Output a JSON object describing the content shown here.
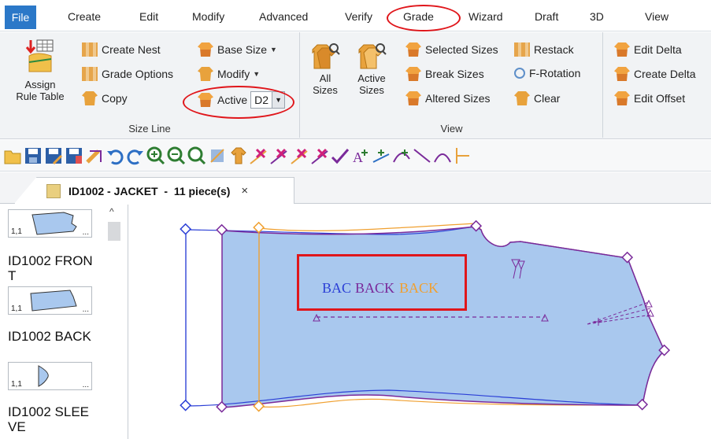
{
  "menu": {
    "file": "File",
    "items": [
      "Create",
      "Edit",
      "Modify",
      "Advanced",
      "Verify",
      "Grade",
      "Wizard",
      "Draft",
      "3D",
      "View"
    ]
  },
  "ribbon": {
    "size_line": {
      "group_label": "Size Line",
      "assign_rule_table": "Assign\nRule Table",
      "create_nest": "Create Nest",
      "grade_options": "Grade Options",
      "copy": "Copy",
      "base_size": "Base Size",
      "modify": "Modify",
      "active_label": "Active",
      "active_value": "D2"
    },
    "view": {
      "group_label": "View",
      "all_sizes": "All\nSizes",
      "active_sizes": "Active\nSizes",
      "selected_sizes": "Selected Sizes",
      "break_sizes": "Break Sizes",
      "altered_sizes": "Altered Sizes",
      "restack": "Restack",
      "f_rotation": "F-Rotation",
      "clear": "Clear"
    },
    "delta": {
      "edit_delta": "Edit Delta",
      "create_delta": "Create Delta",
      "edit_offset": "Edit Offset"
    }
  },
  "toolbar": {
    "icons": [
      "open-icon",
      "save-icon",
      "save-as-icon",
      "save-all-icon",
      "export-icon",
      "undo-icon",
      "redo-icon",
      "zoom-in-icon",
      "zoom-out-icon",
      "zoom-fit-icon",
      "grade-icon",
      "size-icon",
      "delete-point-icon",
      "delete-line-icon",
      "cut-icon",
      "cut-line-icon",
      "check-icon",
      "add-text-icon",
      "add-point-icon",
      "add-curve-icon",
      "line-icon",
      "curve-icon",
      "split-icon"
    ]
  },
  "tab": {
    "title": "ID1002 - JACKET  -  11 piece(s)",
    "close": "×"
  },
  "pieces": [
    {
      "name": "",
      "thumb_num": "1,1",
      "dots": "..."
    },
    {
      "name": "ID1002 FRONT",
      "thumb_num": "1,1",
      "dots": "..."
    },
    {
      "name": "ID1002 BACK",
      "thumb_num": "1,1",
      "dots": "..."
    },
    {
      "name": "ID1002 SLEEVE",
      "thumb_num": "",
      "dots": ""
    }
  ],
  "canvas": {
    "piece_label_1": "BAC",
    "piece_label_2": "BACK",
    "piece_label_3": "BACK",
    "colors": {
      "blue_size": "#2b3fd6",
      "purple_size": "#7a2a9a",
      "orange_size": "#f0a030",
      "fill": "#a9c8ee"
    }
  },
  "annotations": {
    "highlight_color": "#e0161b"
  }
}
